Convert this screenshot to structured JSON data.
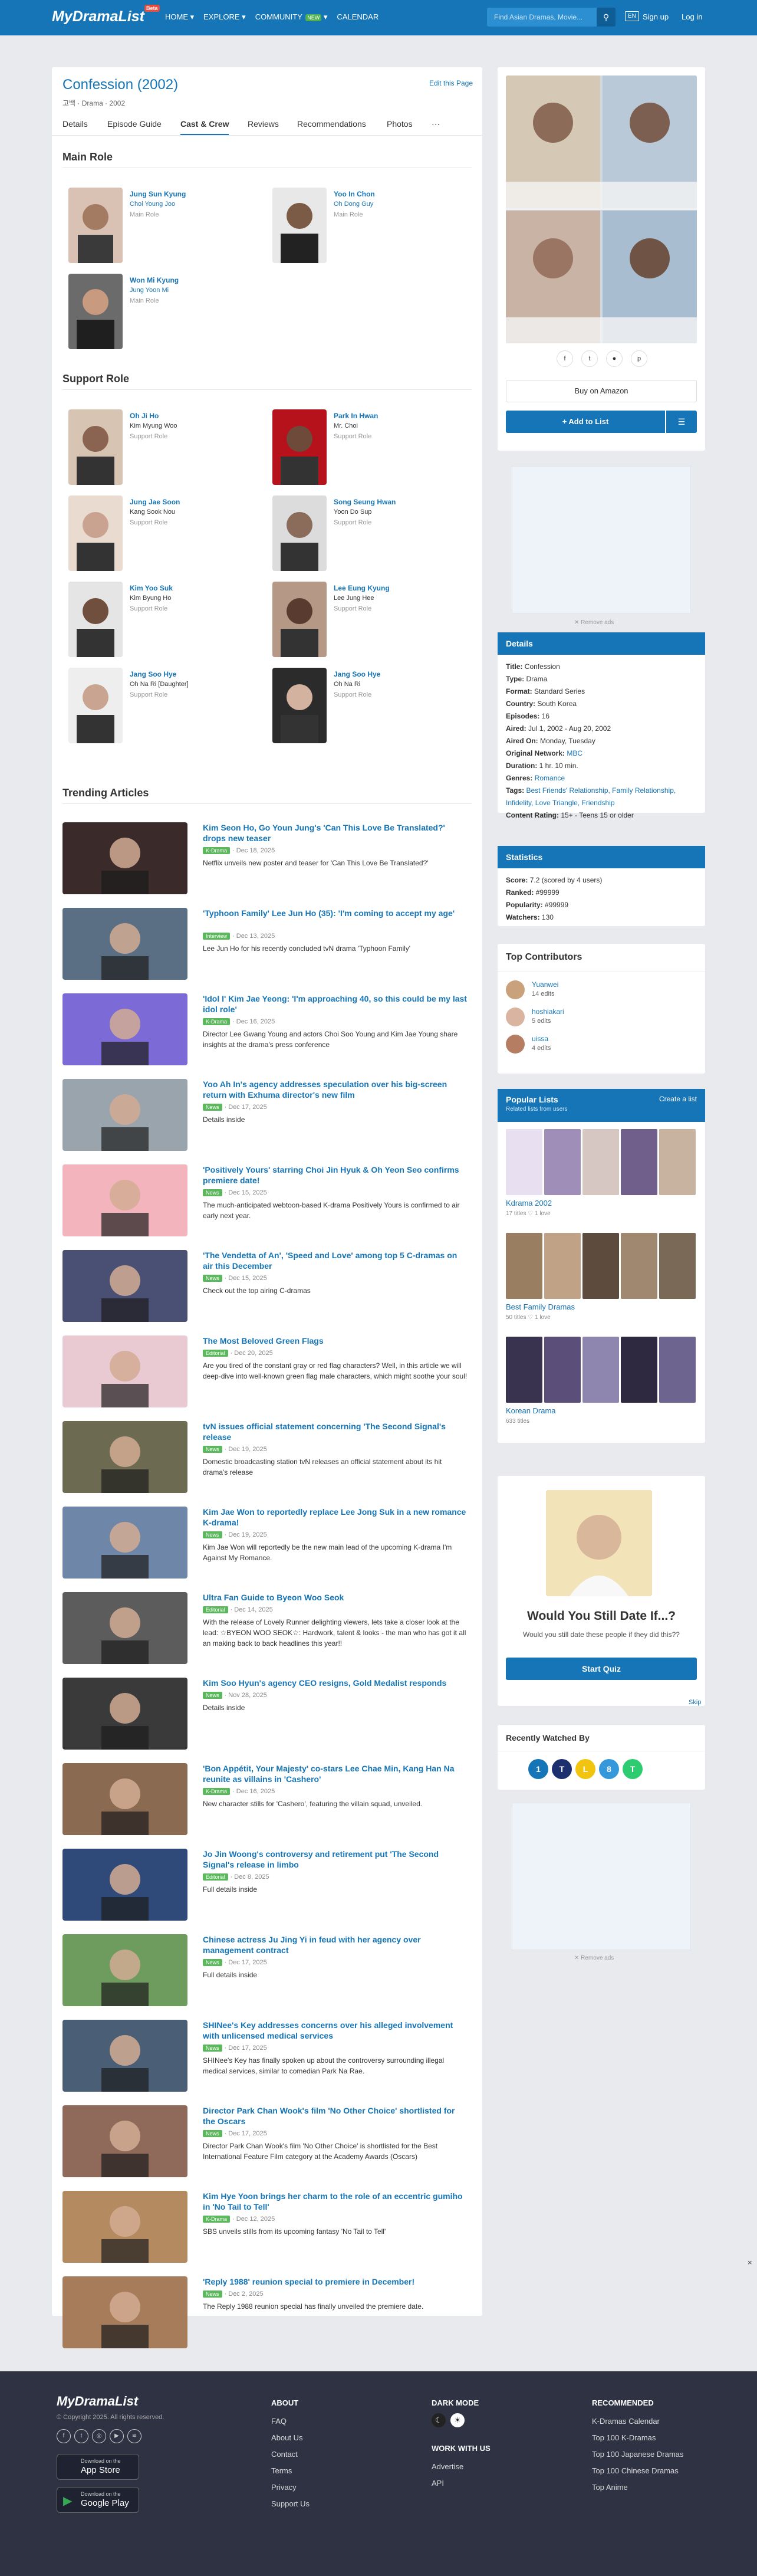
{
  "header": {
    "logo": "MyDramaList",
    "beta": "Beta",
    "nav": [
      "HOME",
      "EXPLORE",
      "COMMUNITY",
      "CALENDAR"
    ],
    "nav_new": "NEW",
    "search_placeholder": "Find Asian Dramas, Movie...",
    "lang": "EN",
    "signup": "Sign up",
    "login": "Log in"
  },
  "drama": {
    "title": "Confession (2002)",
    "native": "고백",
    "sub": "Drama · 2002",
    "edit": "Edit this Page"
  },
  "tabs": [
    "Details",
    "Episode Guide",
    "Cast & Crew",
    "Reviews",
    "Recommendations",
    "Photos"
  ],
  "sections": {
    "main_role": "Main Role",
    "support_role": "Support Role",
    "trending": "Trending Articles"
  },
  "main_cast": [
    {
      "name": "Jung Sun Kyung",
      "char": "Choi Young Joo",
      "role": "Main Role",
      "char_link": true
    },
    {
      "name": "Yoo In Chon",
      "char": "Oh Dong Guy",
      "role": "Main Role",
      "char_link": true
    },
    {
      "name": "Won Mi Kyung",
      "char": "Jung Yoon Mi",
      "role": "Main Role",
      "char_link": true
    }
  ],
  "support_cast": [
    {
      "name": "Oh Ji Ho",
      "char": "Kim Myung Woo",
      "role": "Support Role"
    },
    {
      "name": "Park In Hwan",
      "char": "Mr. Choi",
      "role": "Support Role"
    },
    {
      "name": "Jung Jae Soon",
      "char": "Kang Sook Nou",
      "role": "Support Role"
    },
    {
      "name": "Song Seung Hwan",
      "char": "Yoon Do Sup",
      "role": "Support Role"
    },
    {
      "name": "Kim Yoo Suk",
      "char": "Kim Byung Ho",
      "role": "Support Role"
    },
    {
      "name": "Lee Eung Kyung",
      "char": "Lee Jung Hee",
      "role": "Support Role"
    },
    {
      "name": "Jang Soo Hye",
      "char": "Oh Na Ri [Daughter]",
      "role": "Support Role"
    },
    {
      "name": "Jang Soo Hye",
      "char": "Oh Na Ri",
      "role": "Support Role"
    }
  ],
  "articles": [
    {
      "title": "Kim Seon Ho, Go Youn Jung's 'Can This Love Be Translated?' drops new teaser",
      "tag": "K-Drama",
      "date": "Dec 18, 2025",
      "desc": "Netflix unveils new poster and teaser for 'Can This Love Be Translated?'"
    },
    {
      "title": "'Typhoon Family' Lee Jun Ho (35): 'I'm coming to accept my age'",
      "tag": "Interview",
      "date": "Dec 13, 2025",
      "desc": "Lee Jun Ho for his recently concluded tvN drama 'Typhoon Family'"
    },
    {
      "title": "'Idol I' Kim Jae Yeong: 'I'm approaching 40, so this could be my last idol role'",
      "tag": "K-Drama",
      "date": "Dec 16, 2025",
      "desc": "Director Lee Gwang Young and actors Choi Soo Young and Kim Jae Young share insights at the drama's press conference"
    },
    {
      "title": "Yoo Ah In's agency addresses speculation over his big-screen return with Exhuma director's new film",
      "tag": "News",
      "date": "Dec 17, 2025",
      "desc": "Details inside"
    },
    {
      "title": "'Positively Yours' starring Choi Jin Hyuk & Oh Yeon Seo confirms premiere date!",
      "tag": "News",
      "date": "Dec 15, 2025",
      "desc": "The much-anticipated webtoon-based K-drama Positively Yours is confirmed to air early next year."
    },
    {
      "title": "'The Vendetta of An', 'Speed and Love' among top 5 C-dramas on air this December",
      "tag": "News",
      "date": "Dec 15, 2025",
      "desc": "Check out the top airing C-dramas"
    },
    {
      "title": "The Most Beloved Green Flags",
      "tag": "Editorial",
      "date": "Dec 20, 2025",
      "desc": "Are you tired of the constant gray or red flag characters? Well, in this article we will deep-dive into well-known green flag male characters, which might soothe your soul!"
    },
    {
      "title": "tvN issues official statement concerning 'The Second Signal's release",
      "tag": "News",
      "date": "Dec 19, 2025",
      "desc": "Domestic broadcasting station tvN releases an official statement about its hit drama's release"
    },
    {
      "title": "Kim Jae Won to reportedly replace Lee Jong Suk in a new romance K-drama!",
      "tag": "News",
      "date": "Dec 19, 2025",
      "desc": "Kim Jae Won will reportedly be the new main lead of the upcoming K-drama I'm Against My Romance."
    },
    {
      "title": "Ultra Fan Guide to Byeon Woo Seok",
      "tag": "Editorial",
      "date": "Dec 14, 2025",
      "desc": "With the release of Lovely Runner delighting viewers, lets take a closer look at the lead: ☆BYEON WOO SEOK☆: Hardwork, talent & looks - the man who has got it all an making back to back headlines this year!!"
    },
    {
      "title": "Kim Soo Hyun's agency CEO resigns, Gold Medalist responds",
      "tag": "News",
      "date": "Nov 28, 2025",
      "desc": "Details inside"
    },
    {
      "title": "'Bon Appétit, Your Majesty' co-stars Lee Chae Min, Kang Han Na reunite as villains in 'Cashero'",
      "tag": "K-Drama",
      "date": "Dec 16, 2025",
      "desc": "New character stills for 'Cashero', featuring the villain squad, unveiled."
    },
    {
      "title": "Jo Jin Woong's controversy and retirement put 'The Second Signal's release in limbo",
      "tag": "Editorial",
      "date": "Dec 8, 2025",
      "desc": "Full details inside"
    },
    {
      "title": "Chinese actress Ju Jing Yi in feud with her agency over management contract",
      "tag": "News",
      "date": "Dec 17, 2025",
      "desc": "Full details inside"
    },
    {
      "title": "SHINee's Key addresses concerns over his alleged involvement with unlicensed medical services",
      "tag": "News",
      "date": "Dec 17, 2025",
      "desc": "SHINee's Key has finally spoken up about the controversy surrounding illegal medical services, similar to comedian Park Na Rae."
    },
    {
      "title": "Director Park Chan Wook's film 'No Other Choice' shortlisted for the Oscars",
      "tag": "News",
      "date": "Dec 17, 2025",
      "desc": "Director Park Chan Wook's film 'No Other Choice' is shortlisted for the Best International Feature Film category at the Academy Awards (Oscars)"
    },
    {
      "title": "Kim Hye Yoon brings her charm to the role of an eccentric gumiho in 'No Tail to Tell'",
      "tag": "K-Drama",
      "date": "Dec 12, 2025",
      "desc": "SBS unveils stills from its upcoming fantasy 'No Tail to Tell'"
    },
    {
      "title": "'Reply 1988' reunion special to premiere in December!",
      "tag": "News",
      "date": "Dec 2, 2025",
      "desc": "The Reply 1988 reunion special has finally unveiled the premiere date."
    }
  ],
  "sidebar": {
    "buy": "Buy on Amazon",
    "add": "+ Add to List",
    "remove_ads": "✕ Remove ads",
    "details_h": "Details",
    "details": [
      [
        "Title:",
        "Confession"
      ],
      [
        "Type:",
        "Drama"
      ],
      [
        "Format:",
        "Standard Series"
      ],
      [
        "Country:",
        "South Korea"
      ],
      [
        "Episodes:",
        "16"
      ],
      [
        "Aired:",
        "Jul 1, 2002 - Aug 20, 2002"
      ],
      [
        "Aired On:",
        "Monday, Tuesday"
      ],
      [
        "Original Network:",
        "MBC"
      ],
      [
        "Duration:",
        "1 hr. 10 min."
      ],
      [
        "Genres:",
        "Romance"
      ],
      [
        "Tags:",
        "Best Friends' Relationship, Family Relationship, Infidelity, Love Triangle, Friendship"
      ],
      [
        "Content Rating:",
        "15+ - Teens 15 or older"
      ]
    ],
    "stats_h": "Statistics",
    "stats": [
      [
        "Score:",
        "7.2 (scored by 4 users)"
      ],
      [
        "Ranked:",
        "#99999"
      ],
      [
        "Popularity:",
        "#99999"
      ],
      [
        "Watchers:",
        "130"
      ]
    ],
    "contrib_h": "Top Contributors",
    "contrib": [
      [
        "Yuanwei",
        "14 edits"
      ],
      [
        "hoshiakari",
        "5 edits"
      ],
      [
        "uissa",
        "4 edits"
      ]
    ],
    "lists_h": "Popular Lists",
    "lists_sub": "Related lists from users",
    "lists_create": "Create a list",
    "lists": [
      {
        "name": "Kdrama 2002",
        "titles": "17 titles",
        "love": "1 love"
      },
      {
        "name": "Best Family Dramas",
        "titles": "50 titles",
        "love": "1 love"
      },
      {
        "name": "Korean Drama",
        "titles": "633 titles",
        "love": ""
      }
    ],
    "quiz_title": "Would You Still Date If...?",
    "quiz_sub": "Would you still date these people if they did this??",
    "quiz_btn": "Start Quiz",
    "skip": "Skip",
    "recent_h": "Recently Watched By",
    "recent": [
      "1",
      "T",
      "L",
      "8",
      "T"
    ]
  },
  "colors": {
    "brand": "#1675b6",
    "footer": "#2f3243",
    "tag": "#5cb85c"
  },
  "footer": {
    "logo": "MyDramaList",
    "copy": "© Copyright 2025. All rights reserved.",
    "appstore_small": "Download on the",
    "appstore": "App Store",
    "gplay_small": "Download on the",
    "gplay": "Google Play",
    "about_h": "ABOUT",
    "about": [
      "FAQ",
      "About Us",
      "Contact",
      "Terms",
      "Privacy",
      "Support Us"
    ],
    "dark_h": "DARK MODE",
    "work_h": "WORK WITH US",
    "work": [
      "Advertise",
      "API"
    ],
    "rec_h": "RECOMMENDED",
    "rec": [
      "K-Dramas Calendar",
      "Top 100 K-Dramas",
      "Top 100 Japanese Dramas",
      "Top 100 Chinese Dramas",
      "Top Anime"
    ]
  }
}
